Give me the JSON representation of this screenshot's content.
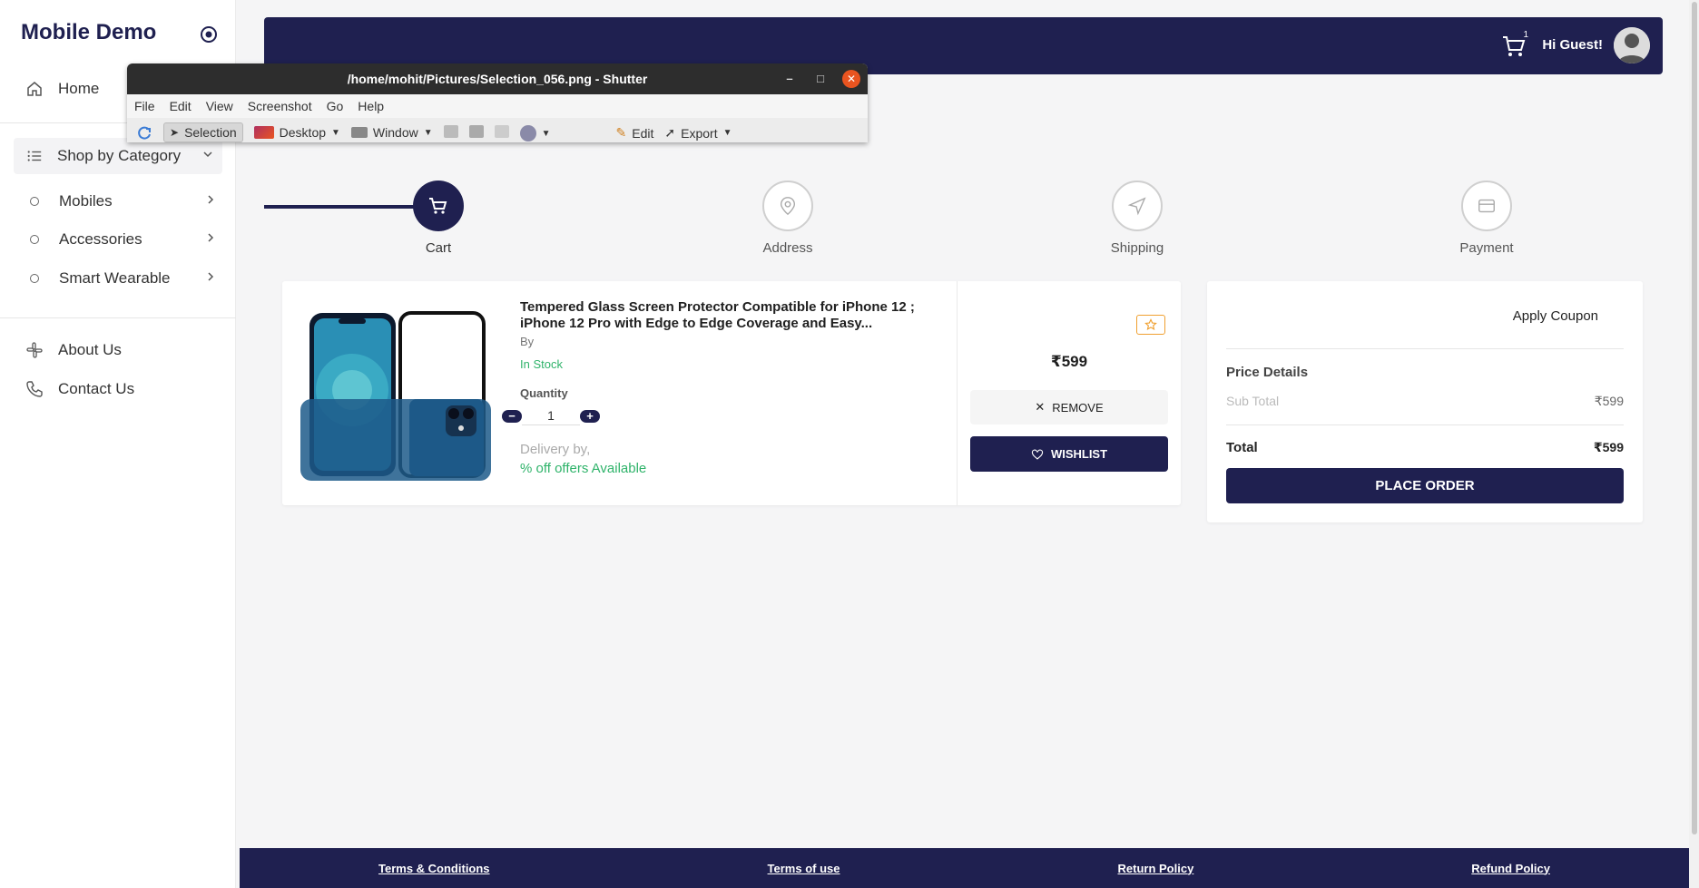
{
  "sidebar": {
    "brand": "Mobile Demo",
    "home": "Home",
    "shop_by_category": "Shop by Category",
    "categories": [
      {
        "label": "Mobiles"
      },
      {
        "label": "Accessories"
      },
      {
        "label": "Smart Wearable"
      }
    ],
    "about": "About Us",
    "contact": "Contact Us"
  },
  "header": {
    "cart_count": "1",
    "greeting": "Hi Guest!"
  },
  "shutter": {
    "title": "/home/mohit/Pictures/Selection_056.png - Shutter",
    "menu": [
      "File",
      "Edit",
      "View",
      "Screenshot",
      "Go",
      "Help"
    ],
    "tools": {
      "selection": "Selection",
      "desktop": "Desktop",
      "window": "Window",
      "edit": "Edit",
      "export": "Export"
    }
  },
  "stepper": {
    "steps": [
      {
        "label": "Cart",
        "icon": "cart-icon",
        "done": true
      },
      {
        "label": "Address",
        "icon": "location-pin-icon",
        "done": false
      },
      {
        "label": "Shipping",
        "icon": "navigation-arrow-icon",
        "done": false
      },
      {
        "label": "Payment",
        "icon": "card-icon",
        "done": false
      }
    ]
  },
  "cart_item": {
    "name": "Tempered Glass Screen Protector Compatible for iPhone 12 ; iPhone 12 Pro with Edge to Edge Coverage and Easy...",
    "by": "By",
    "stock": "In Stock",
    "quantity_label": "Quantity",
    "quantity": "1",
    "delivery": "Delivery by,",
    "offers": "% off offers Available",
    "price": "₹599",
    "remove_label": "REMOVE",
    "wishlist_label": "WISHLIST"
  },
  "summary": {
    "apply_coupon": "Apply Coupon",
    "price_details": "Price Details",
    "sub_total_label": "Sub Total",
    "sub_total_value": "₹599",
    "total_label": "Total",
    "total_value": "₹599",
    "place_order": "PLACE ORDER"
  },
  "footer": {
    "links": [
      "Terms & Conditions",
      "Terms of use",
      "Return Policy",
      "Refund Policy"
    ]
  },
  "colors": {
    "primary": "#1f2050",
    "success": "#2fb36a",
    "accent": "#f0a030",
    "shutter_close": "#e95420"
  }
}
